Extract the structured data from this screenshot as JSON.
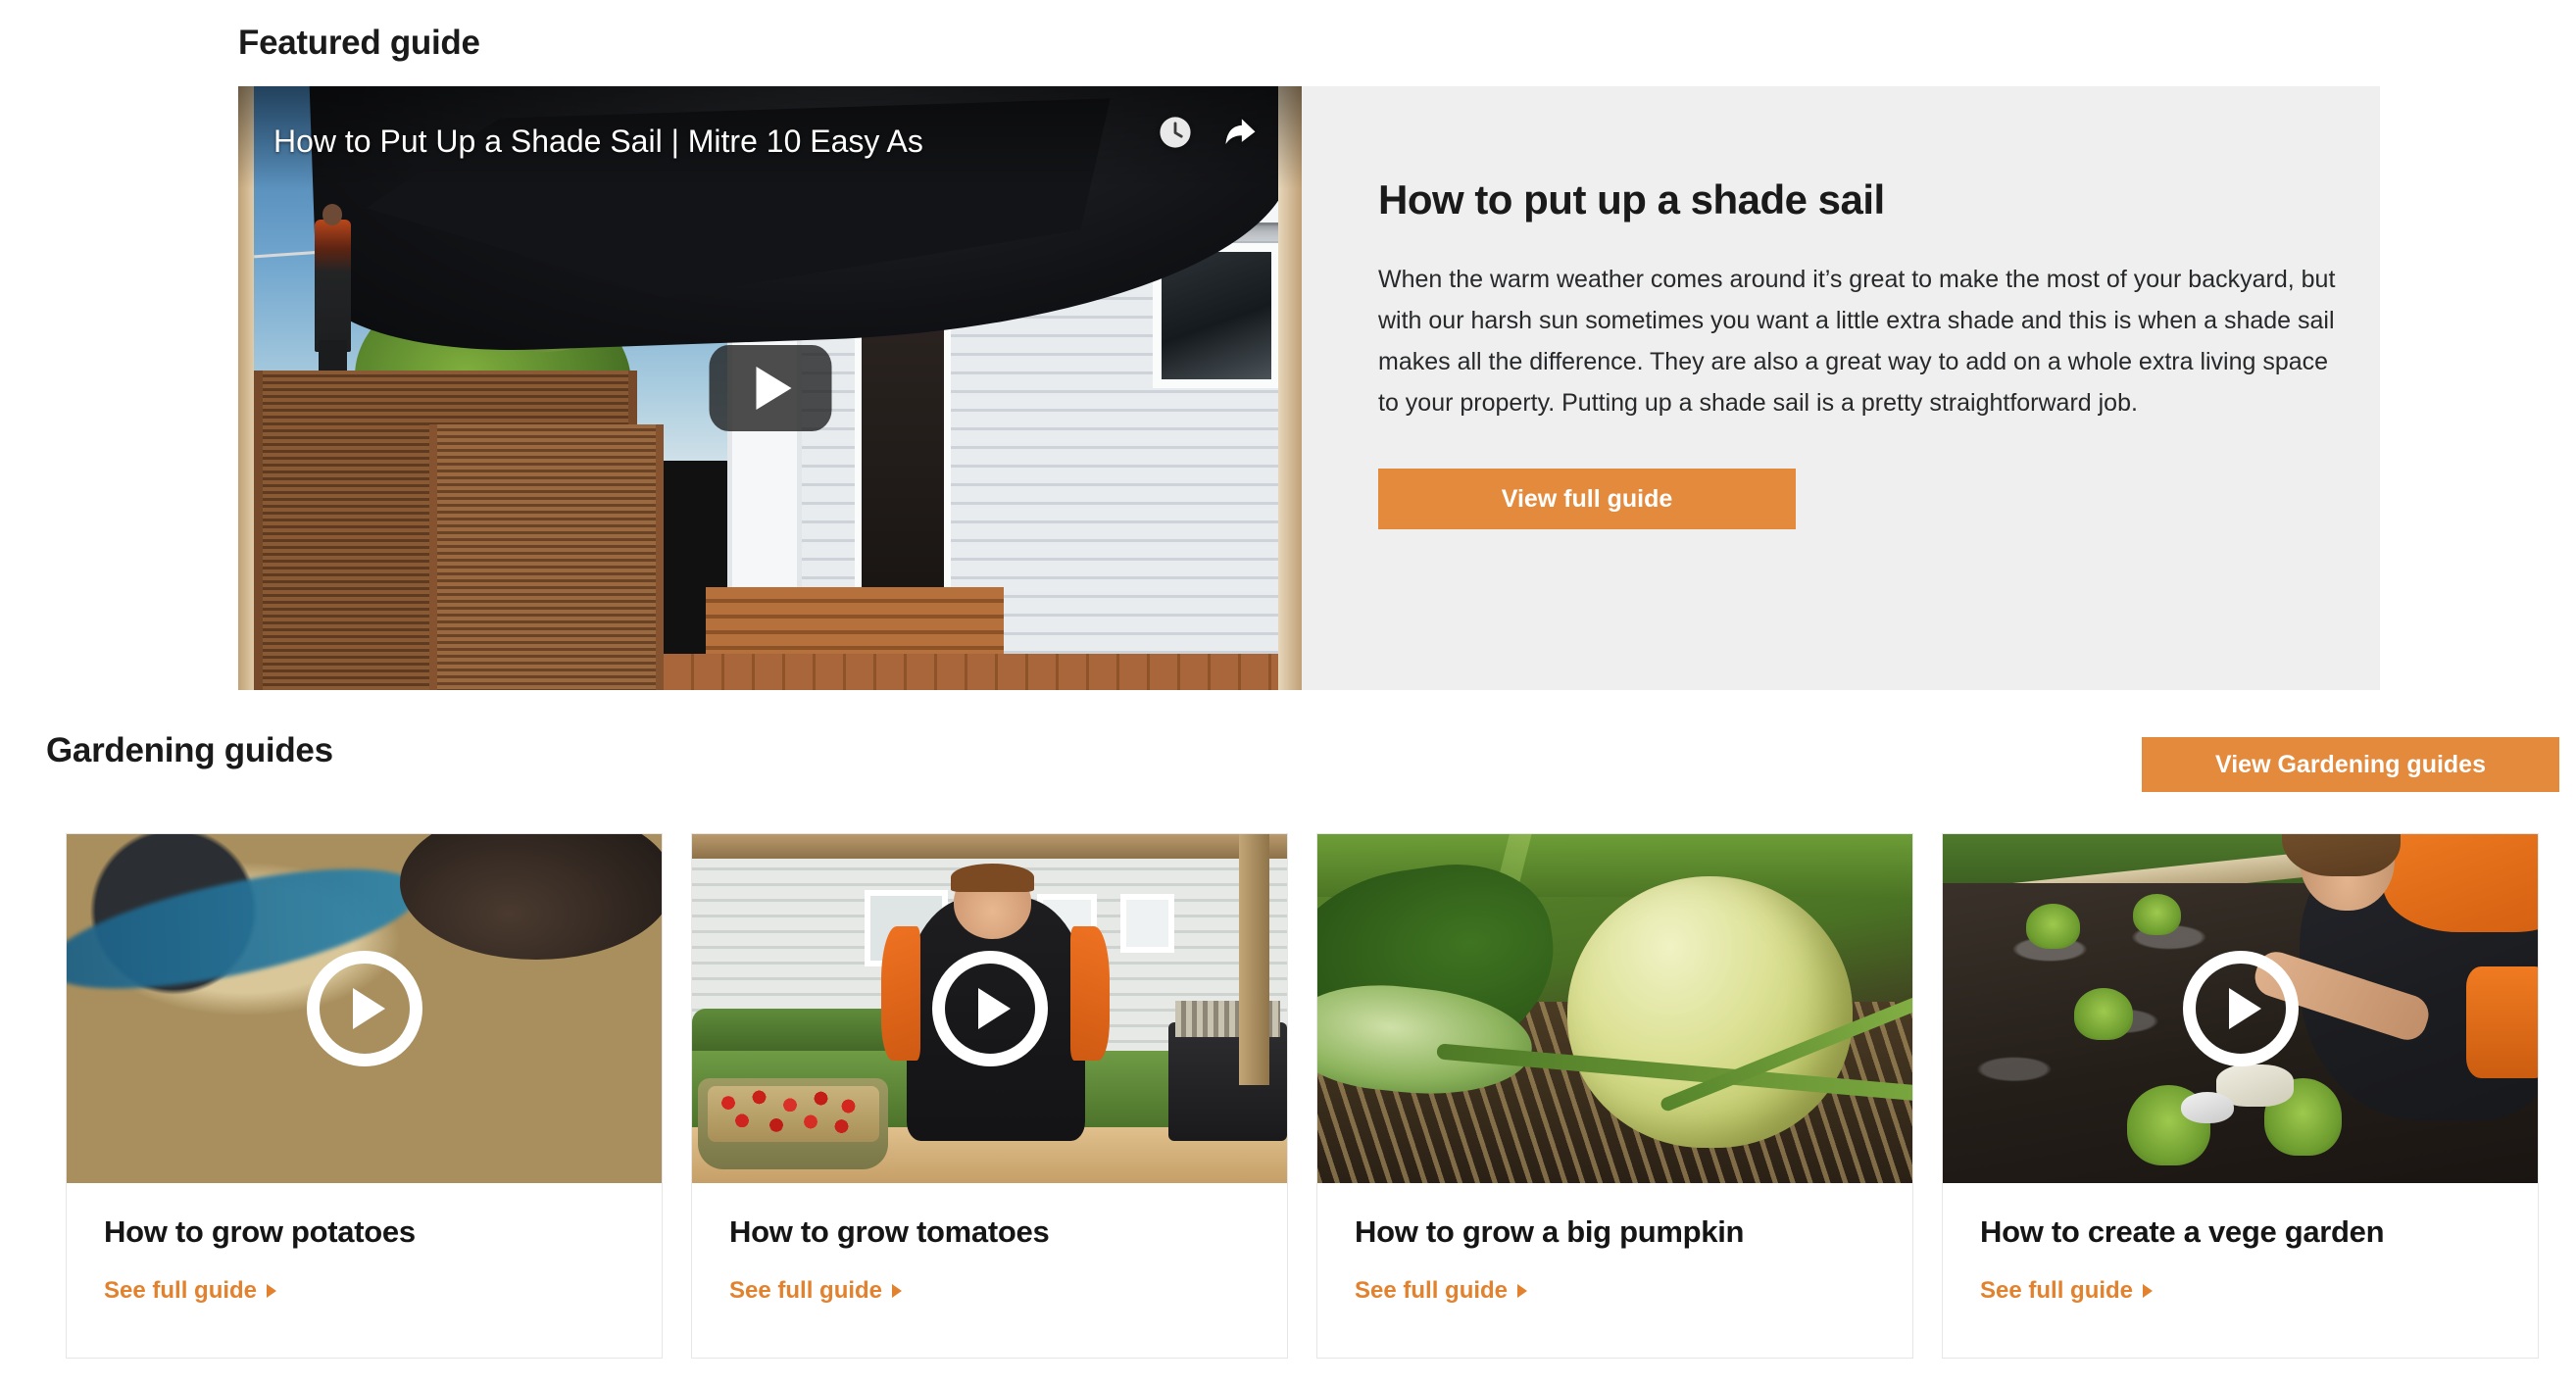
{
  "featured": {
    "heading": "Featured guide",
    "video": {
      "title": "How to Put Up a Shade Sail | Mitre 10 Easy As",
      "watch_later_icon": "clock-icon",
      "share_icon": "share-icon",
      "play_icon": "youtube-play-icon"
    },
    "title": "How to put up a shade sail",
    "body": "When the warm weather comes around it’s great to make the most of your backyard, but with our harsh sun sometimes you want a little extra shade and this is when a shade sail makes all the difference. They are also a great way to add on a whole extra living space to your property. Putting up a shade sail is a pretty straightforward job.",
    "cta_label": "View full guide"
  },
  "gardening": {
    "heading": "Gardening guides",
    "cta_label": "View Gardening guides",
    "cards": [
      {
        "title": "How to grow potatoes",
        "link_label": "See full guide",
        "has_play": true
      },
      {
        "title": "How to grow tomatoes",
        "link_label": "See full guide",
        "has_play": true
      },
      {
        "title": "How to grow a big pumpkin",
        "link_label": "See full guide",
        "has_play": false
      },
      {
        "title": "How to create a vege garden",
        "link_label": "See full guide",
        "has_play": true
      }
    ]
  },
  "colors": {
    "accent_orange": "#e38a3d",
    "link_orange": "#e2822e",
    "panel_gray": "#efefef",
    "card_border": "#e6e6e6",
    "text_dark": "#1a1a1a"
  }
}
